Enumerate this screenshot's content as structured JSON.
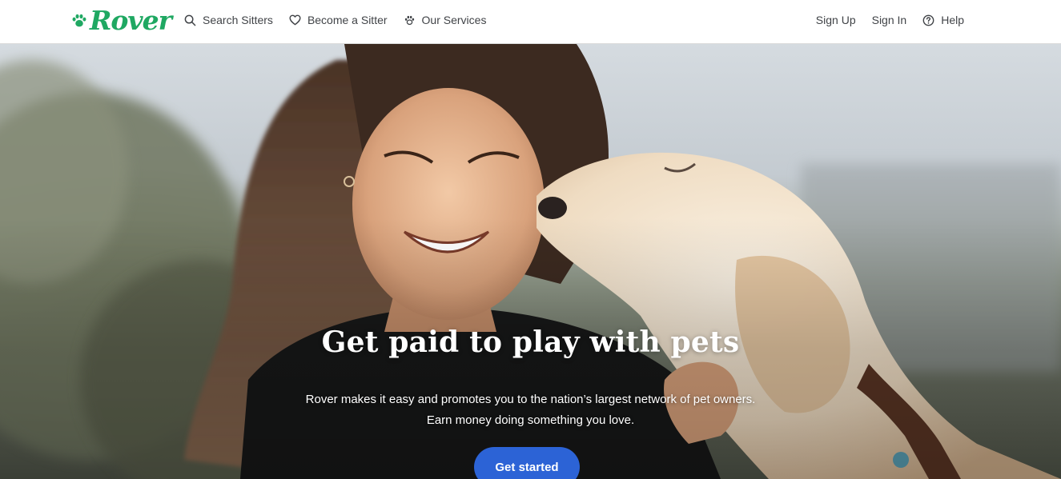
{
  "header": {
    "logo_text": "Rover",
    "logo_icon": "paw-icon",
    "nav_left": [
      {
        "label": "Search Sitters",
        "icon": "search-icon"
      },
      {
        "label": "Become a Sitter",
        "icon": "heart-icon"
      },
      {
        "label": "Our Services",
        "icon": "paw-icon"
      }
    ],
    "nav_right": [
      {
        "label": "Sign Up"
      },
      {
        "label": "Sign In"
      },
      {
        "label": "Help",
        "icon": "question-circle-icon"
      }
    ]
  },
  "hero": {
    "title": "Get paid to play with pets",
    "subtitle_line1": "Rover makes it easy and promotes you to the nation’s largest network of pet owners.",
    "subtitle_line2": "Earn money doing something you love.",
    "cta_label": "Get started"
  },
  "colors": {
    "brand_green": "#1fa862",
    "cta_blue": "#2c63d6",
    "nav_text": "#404347"
  }
}
